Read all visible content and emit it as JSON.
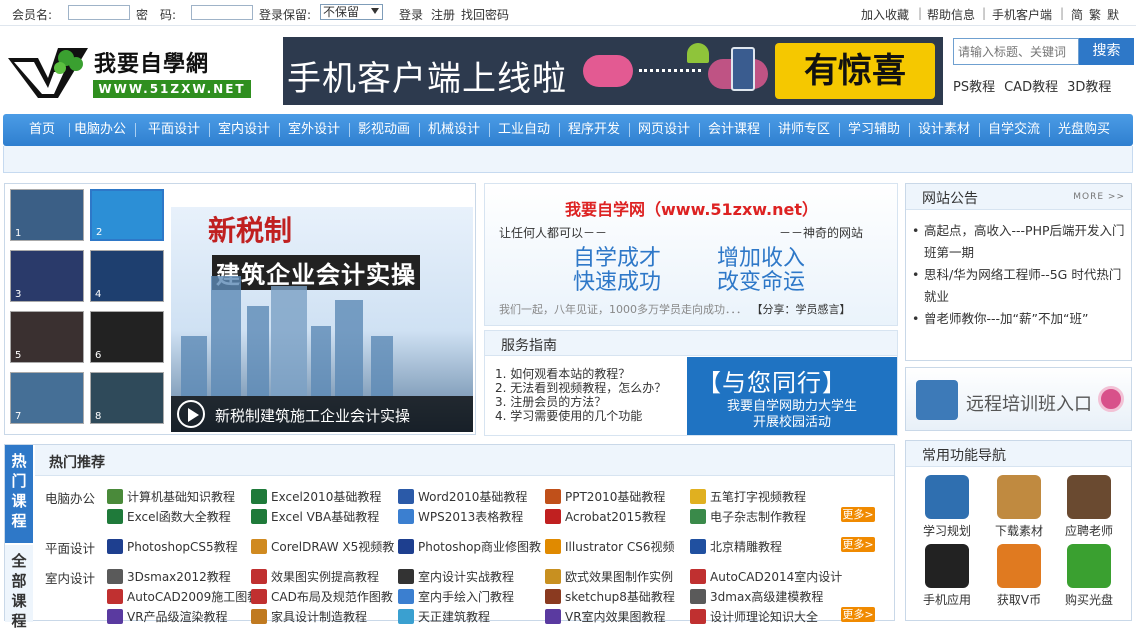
{
  "topbar": {
    "member_label": "会员名:",
    "password_label": "密　码:",
    "keep_label": "登录保留:",
    "keep_selected": "不保留",
    "login": "登录",
    "register": "注册",
    "find_pwd": "找回密码",
    "favorites": "加入收藏",
    "help": "帮助信息",
    "mobile": "手机客户端",
    "simp": "简",
    "trad": "繁",
    "default": "默"
  },
  "header": {
    "logo_title": "我要自學網",
    "logo_url": "WWW.51ZXW.NET",
    "banner_text": "手机客户端上线啦",
    "banner_surprise": "有惊喜",
    "search_placeholder": "请输入标题、关键词",
    "search_button": "搜索",
    "tags": [
      "PS教程",
      "CAD教程",
      "3D教程"
    ]
  },
  "nav": [
    "首页",
    "电脑办公",
    "平面设计",
    "室内设计",
    "室外设计",
    "影视动画",
    "机械设计",
    "工业自动",
    "程序开发",
    "网页设计",
    "会计课程",
    "讲师专区",
    "学习辅助",
    "设计素材",
    "自学交流",
    "光盘购买"
  ],
  "slider": {
    "title": "新税制",
    "subtitle": "建筑企业会计实操",
    "caption": "新税制建筑施工企业会计实操",
    "thumbs": [
      "1",
      "2",
      "3",
      "4",
      "5",
      "6",
      "7",
      "8"
    ],
    "thumb_colors": [
      "#3b5f86",
      "#2c8fd6",
      "#2a3a6a",
      "#1e3f6f",
      "#3a3030",
      "#222",
      "#456f96",
      "#2f4a5a"
    ]
  },
  "intro": {
    "heading": "我要自学网（www.51zxw.net）",
    "left_line": "让任何人都可以－－",
    "right_line": "－－神奇的网站",
    "phrase1": "自学成才",
    "phrase2": "增加收入",
    "phrase3": "快速成功",
    "phrase4": "改变命运",
    "bottom": "我们一起，八年见证，1000多万学员走向成功．．．",
    "share": "【分享：学员感言】"
  },
  "guide": {
    "title": "服务指南",
    "items": [
      "1. 如何观看本站的教程？",
      "2. 无法看到视频教程，怎么办？",
      "3. 注册会员的方法？",
      "4. 学习需要使用的几个功能"
    ],
    "ad_title": "【与您同行】",
    "ad_line1": "我要自学网助力大学生",
    "ad_line2": "开展校园活动"
  },
  "notice": {
    "title": "网站公告",
    "more": "MORE >>",
    "items": [
      "高起点，高收入---PHP后端开发入门班第一期",
      "思科/华为网络工程师--5G 时代热门就业",
      "曾老师教你---加“薪”不加“班”"
    ]
  },
  "remote": {
    "label": "远程培训班入口"
  },
  "hot": {
    "tab_active": "热门课程",
    "tab_other": "全部课程",
    "title": "热门推荐",
    "more": "更多>",
    "categories": [
      "电脑办公",
      "平面设计",
      "室内设计"
    ],
    "row1": [
      "计算机基础知识教程",
      "Excel2010基础教程",
      "Word2010基础教程",
      "PPT2010基础教程",
      "五笔打字视频教程"
    ],
    "row2": [
      "Excel函数大全教程",
      "Excel VBA基础教程",
      "WPS2013表格教程",
      "Acrobat2015教程",
      "电子杂志制作教程"
    ],
    "row3": [
      "PhotoshopCS5教程",
      "CorelDRAW X5视频教",
      "Photoshop商业修图教",
      "Illustrator CS6视频",
      "北京精雕教程"
    ],
    "row4": [
      "3Dsmax2012教程",
      "效果图实例提高教程",
      "室内设计实战教程",
      "欧式效果图制作实例",
      "AutoCAD2014室内设计"
    ],
    "row5": [
      "AutoCAD2009施工图教",
      "CAD布局及规范作图教",
      "室内手绘入门教程",
      "sketchup8基础教程",
      "3dmax高级建模教程"
    ],
    "row6": [
      "VR产品级渲染教程",
      "家具设计制造教程",
      "天正建筑教程",
      "VR室内效果图教程",
      "设计师理论知识大全"
    ],
    "icon_colors": {
      "row1": [
        "#4a8a3a",
        "#1f7a3a",
        "#2b5aa8",
        "#c0501a",
        "#e0b020"
      ],
      "row2": [
        "#1f7a3a",
        "#1f7a3a",
        "#3b7fd0",
        "#c02020",
        "#3a8a4a"
      ],
      "row3": [
        "#1e3f8f",
        "#d08a20",
        "#1e3f8f",
        "#e08a00",
        "#2050a0"
      ],
      "row4": [
        "#5a5a5a",
        "#c03030",
        "#333",
        "#c89020",
        "#c03030"
      ],
      "row5": [
        "#c03030",
        "#c03030",
        "#3b7fd0",
        "#8a3a20",
        "#5a5a5a"
      ],
      "row6": [
        "#5a3aa0",
        "#c07a20",
        "#3aa0d0",
        "#5a3aa0",
        "#c03030"
      ]
    }
  },
  "func": {
    "title": "常用功能导航",
    "items": [
      "学习规划",
      "下载素材",
      "应聘老师",
      "手机应用",
      "获取V币",
      "购买光盘"
    ],
    "colors": [
      "#2f6fb0",
      "#c08a40",
      "#6a4a30",
      "#222",
      "#e07a20",
      "#3aa030"
    ]
  }
}
